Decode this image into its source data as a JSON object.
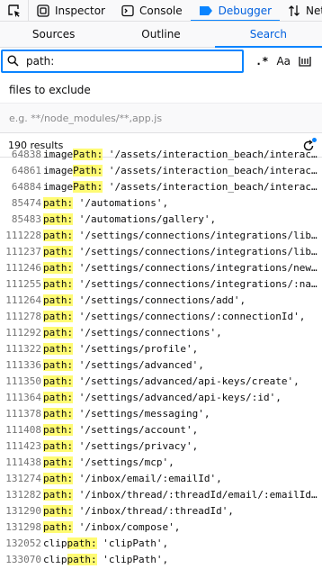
{
  "toolbar": {
    "tools": [
      {
        "label": "Inspector",
        "icon": "inspector-icon"
      },
      {
        "label": "Console",
        "icon": "console-icon"
      },
      {
        "label": "Debugger",
        "icon": "debugger-icon"
      },
      {
        "label": "Netw",
        "icon": "network-icon"
      }
    ],
    "accent": "#0a84ff"
  },
  "subtabs": [
    "Sources",
    "Outline",
    "Search"
  ],
  "search": {
    "value": "path:",
    "regex_label": ".*",
    "case_label": "Aa"
  },
  "exclude": {
    "label": "files to exclude",
    "placeholder": "e.g. **/node_modules/**,app.js"
  },
  "results_count": "190 results",
  "results": [
    {
      "line": "64838",
      "pre": "image",
      "match": "Path:",
      "post": " '/assets/interaction_beach/interac…"
    },
    {
      "line": "64861",
      "pre": "image",
      "match": "Path:",
      "post": " '/assets/interaction_beach/interac…"
    },
    {
      "line": "64884",
      "pre": "image",
      "match": "Path:",
      "post": " '/assets/interaction_beach/interac…"
    },
    {
      "line": "85474",
      "pre": "",
      "match": "path:",
      "post": " '/automations',"
    },
    {
      "line": "85483",
      "pre": "",
      "match": "path:",
      "post": " '/automations/gallery',"
    },
    {
      "line": "111228",
      "pre": "",
      "match": "path:",
      "post": " '/settings/connections/integrations/lib…"
    },
    {
      "line": "111237",
      "pre": "",
      "match": "path:",
      "post": " '/settings/connections/integrations/lib…"
    },
    {
      "line": "111246",
      "pre": "",
      "match": "path:",
      "post": " '/settings/connections/integrations/new…"
    },
    {
      "line": "111255",
      "pre": "",
      "match": "path:",
      "post": " '/settings/connections/integrations/:na…"
    },
    {
      "line": "111264",
      "pre": "",
      "match": "path:",
      "post": " '/settings/connections/add',"
    },
    {
      "line": "111278",
      "pre": "",
      "match": "path:",
      "post": " '/settings/connections/:connectionId',"
    },
    {
      "line": "111292",
      "pre": "",
      "match": "path:",
      "post": " '/settings/connections',"
    },
    {
      "line": "111322",
      "pre": "",
      "match": "path:",
      "post": " '/settings/profile',"
    },
    {
      "line": "111336",
      "pre": "",
      "match": "path:",
      "post": " '/settings/advanced',"
    },
    {
      "line": "111350",
      "pre": "",
      "match": "path:",
      "post": " '/settings/advanced/api-keys/create',"
    },
    {
      "line": "111364",
      "pre": "",
      "match": "path:",
      "post": " '/settings/advanced/api-keys/:id',"
    },
    {
      "line": "111378",
      "pre": "",
      "match": "path:",
      "post": " '/settings/messaging',"
    },
    {
      "line": "111408",
      "pre": "",
      "match": "path:",
      "post": " '/settings/account',"
    },
    {
      "line": "111423",
      "pre": "",
      "match": "path:",
      "post": " '/settings/privacy',"
    },
    {
      "line": "111438",
      "pre": "",
      "match": "path:",
      "post": " '/settings/mcp',"
    },
    {
      "line": "131274",
      "pre": "",
      "match": "path:",
      "post": " '/inbox/email/:emailId',"
    },
    {
      "line": "131282",
      "pre": "",
      "match": "path:",
      "post": " '/inbox/thread/:threadId/email/:emailId…"
    },
    {
      "line": "131290",
      "pre": "",
      "match": "path:",
      "post": " '/inbox/thread/:threadId',"
    },
    {
      "line": "131298",
      "pre": "",
      "match": "path:",
      "post": " '/inbox/compose',"
    },
    {
      "line": "132052",
      "pre": "clip",
      "match": "path:",
      "post": " 'clipPath',"
    },
    {
      "line": "133070",
      "pre": "clip",
      "match": "path:",
      "post": " 'clipPath',"
    }
  ]
}
